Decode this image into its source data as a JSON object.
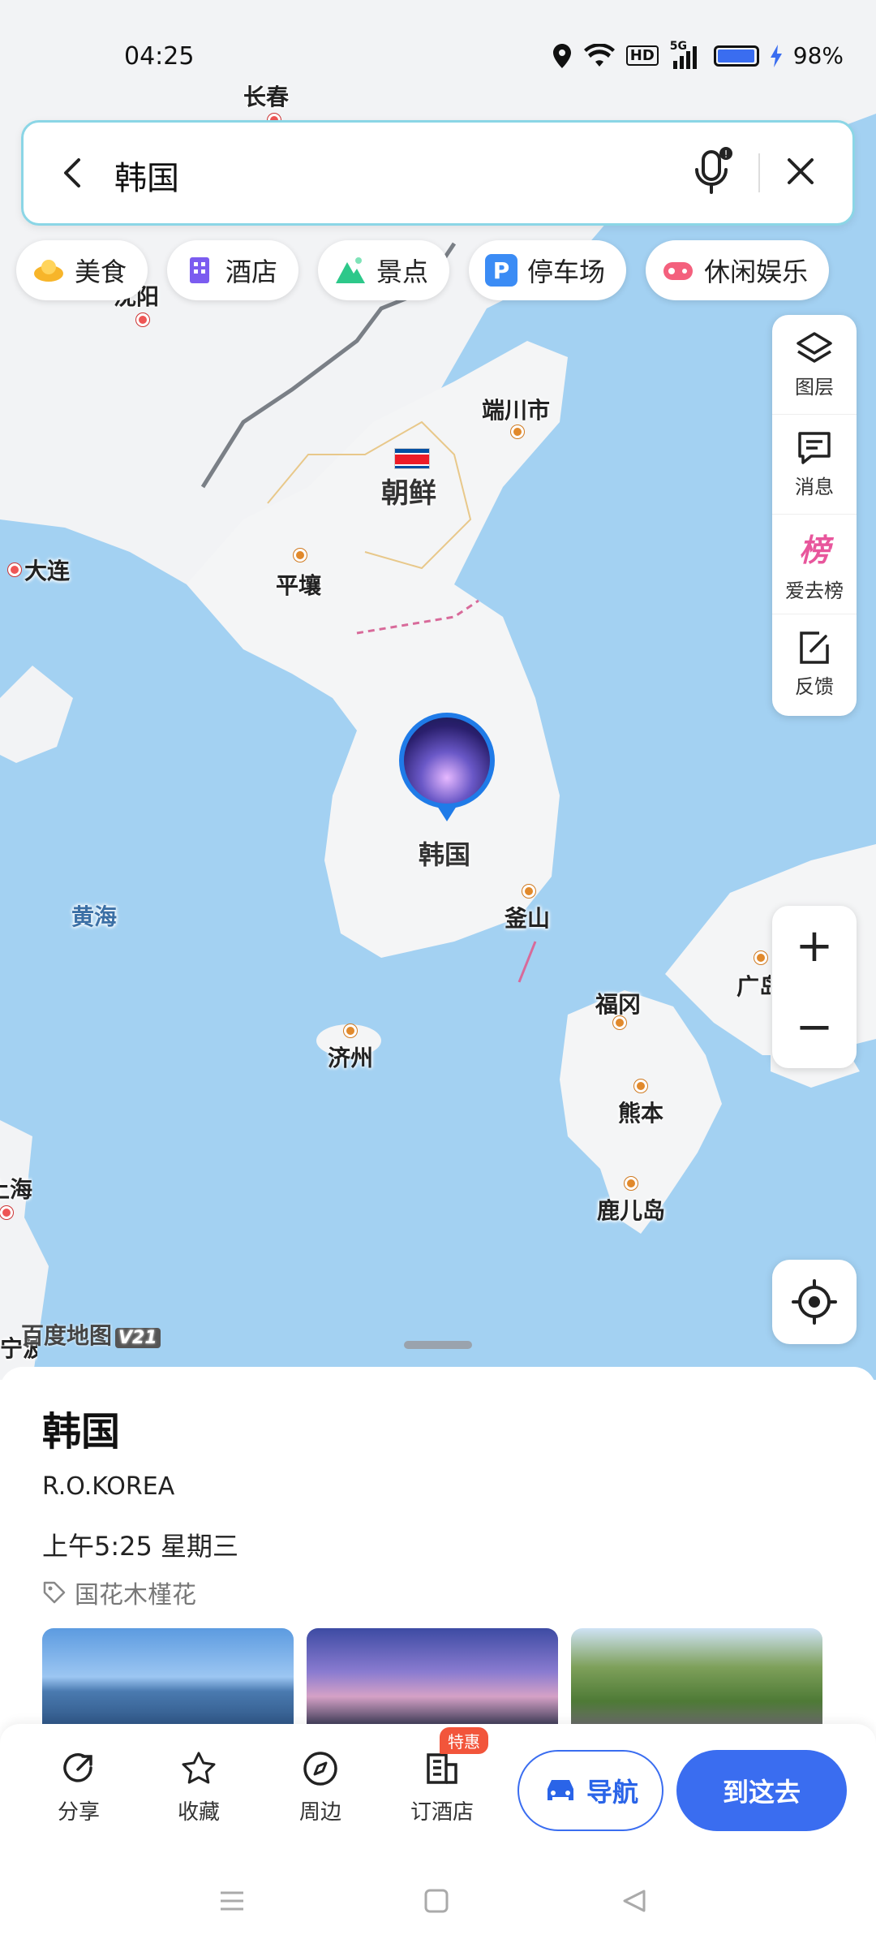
{
  "status_bar": {
    "time": "04:25",
    "network": "5G",
    "hd": "HD",
    "battery": "98%",
    "battery_level": 0.98
  },
  "search": {
    "query": "韩国"
  },
  "categories": [
    {
      "label": "美食",
      "icon": "food-icon",
      "color": "#f7b52a"
    },
    {
      "label": "酒店",
      "icon": "hotel-icon",
      "color": "#7b5cf0"
    },
    {
      "label": "景点",
      "icon": "scenic-icon",
      "color": "#2dc88a"
    },
    {
      "label": "停车场",
      "icon": "parking-icon",
      "color": "#3b8cf5"
    },
    {
      "label": "休闲娱乐",
      "icon": "entertainment-icon",
      "color": "#f4607d"
    }
  ],
  "tools": [
    {
      "label": "图层",
      "icon": "layers-icon"
    },
    {
      "label": "消息",
      "icon": "message-icon"
    },
    {
      "label": "爱去榜",
      "icon": "ranking-icon",
      "glyph": "榜"
    },
    {
      "label": "反馈",
      "icon": "feedback-icon"
    }
  ],
  "zoom": {
    "in": "+",
    "out": "−"
  },
  "map": {
    "labels": {
      "changchun": "长春",
      "shenyang": "沈阳",
      "dalian": "大连",
      "tanchuan": "端川市",
      "north_korea": "朝鲜",
      "pyongyang": "平壤",
      "south_korea": "韩国",
      "busan": "釜山",
      "yellow_sea": "黄海",
      "jeju": "济州",
      "fukuoka": "福冈",
      "kumamoto": "熊本",
      "kagoshima": "鹿儿岛",
      "hiroshima": "广岛",
      "shanghai": "上海",
      "ningbo": "宁波"
    },
    "watermark": "百度地图",
    "watermark_version": "V21"
  },
  "place": {
    "name": "韩国",
    "english_name": "R.O.KOREA",
    "local_time": "上午5:25 星期三",
    "tag": "国花木槿花"
  },
  "actions": {
    "share": "分享",
    "favorite": "收藏",
    "nearby": "周边",
    "hotel": "订酒店",
    "hotel_badge": "特惠",
    "navigate": "导航",
    "go_here": "到这去"
  },
  "colors": {
    "accent": "#3a6df0",
    "sea": "#a3d1f2",
    "land": "#f1f2f4"
  }
}
